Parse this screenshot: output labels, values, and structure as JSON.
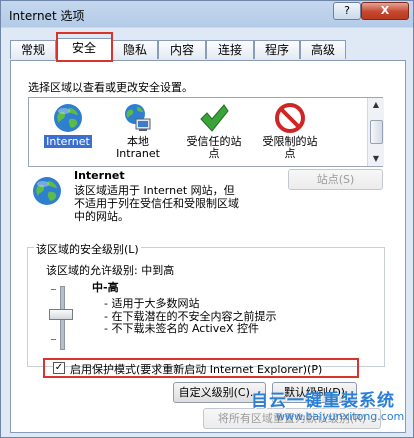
{
  "window": {
    "title": "Internet 选项",
    "help_label": "?",
    "close_label": "X"
  },
  "tabs": [
    "常规",
    "安全",
    "隐私",
    "内容",
    "连接",
    "程序",
    "高级"
  ],
  "security": {
    "instruction": "选择区域以查看或更改安全设置。",
    "zones": [
      {
        "icon": "globe-icon",
        "label": "Internet"
      },
      {
        "icon": "local-intranet-icon",
        "label": "本地\nIntranet"
      },
      {
        "icon": "checkmark-icon",
        "label": "受信任的站\n点"
      },
      {
        "icon": "restricted-icon",
        "label": "受限制的站\n点"
      }
    ],
    "selected_zone": {
      "name": "Internet",
      "description": "该区域适用于 Internet 网站，但\n不适用于列在受信任和受限制区域\n中的网站。",
      "sites_button": "站点(S)"
    },
    "level_group_title": "该区域的安全级别(L)",
    "allowed_levels": "该区域的允许级别: 中到高",
    "level_name": "中-高",
    "level_bullets": [
      "- 适用于大多数网站",
      "- 在下载潜在的不安全内容之前提示",
      "- 不下载未签名的 ActiveX 控件"
    ],
    "protected_mode_label": "启用保护模式(要求重新启动 Internet Explorer)(P)",
    "protected_mode_checked": true,
    "custom_level_button": "自定义级别(C)...",
    "default_level_button": "默认级别(D)",
    "reset_all_button": "将所有区域重置为默认级别(R)"
  },
  "watermark": {
    "line1": "自云一键重装系统",
    "line2": "www.baiyunxitong.com"
  }
}
